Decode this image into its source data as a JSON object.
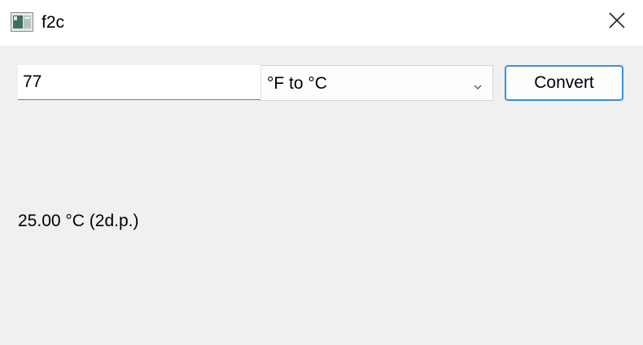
{
  "window": {
    "title": "f2c",
    "icons": {
      "app": "app-window-icon",
      "close": "close-icon"
    }
  },
  "form": {
    "value": "77",
    "unit_selected": "°F to °C",
    "convert_label": "Convert"
  },
  "result": {
    "text": "25.00 °C (2d.p.)"
  },
  "colors": {
    "window_bg": "#f0f0f0",
    "titlebar_bg": "#ffffff",
    "accent_border": "#3c8fd8"
  }
}
